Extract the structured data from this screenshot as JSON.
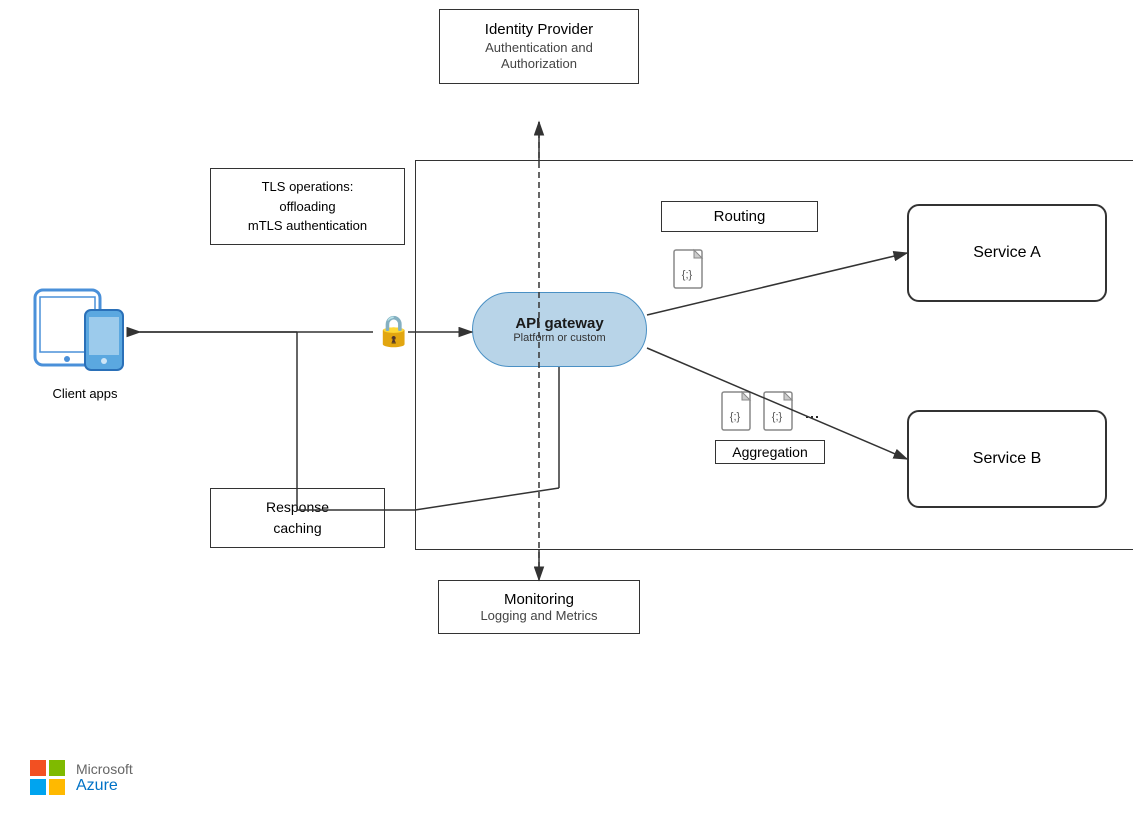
{
  "identity": {
    "title": "Identity Provider",
    "subtitle": "Authentication and Authorization"
  },
  "tls": {
    "label": "TLS operations:\noffloading\nmTLS authentication"
  },
  "api_gateway": {
    "title": "API gateway",
    "subtitle": "Platform or custom"
  },
  "routing": {
    "label": "Routing"
  },
  "service_a": {
    "label": "Service A"
  },
  "service_b": {
    "label": "Service B"
  },
  "aggregation": {
    "label": "Aggregation"
  },
  "response": {
    "label": "Response\ncaching"
  },
  "monitoring": {
    "title": "Monitoring",
    "subtitle": "Logging\nand Metrics"
  },
  "client": {
    "label": "Client apps"
  },
  "azure": {
    "microsoft": "Microsoft",
    "azure": "Azure"
  }
}
